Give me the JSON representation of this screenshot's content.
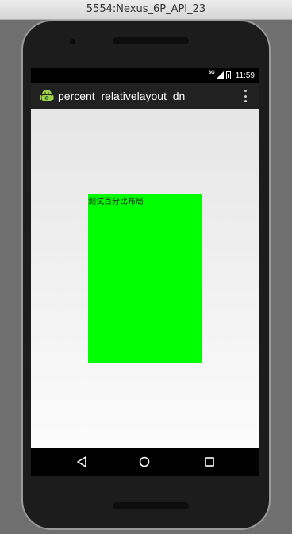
{
  "window": {
    "title": "5554:Nexus_6P_API_23"
  },
  "statusbar": {
    "network_label": "3G",
    "time": "11:59"
  },
  "actionbar": {
    "app_title": "percent_relativelayout_dn"
  },
  "content": {
    "box_text": "测试百分比布局",
    "box_color": "#00ff00"
  },
  "navbar": {
    "buttons": [
      "back-icon",
      "home-icon",
      "recents-icon"
    ]
  }
}
